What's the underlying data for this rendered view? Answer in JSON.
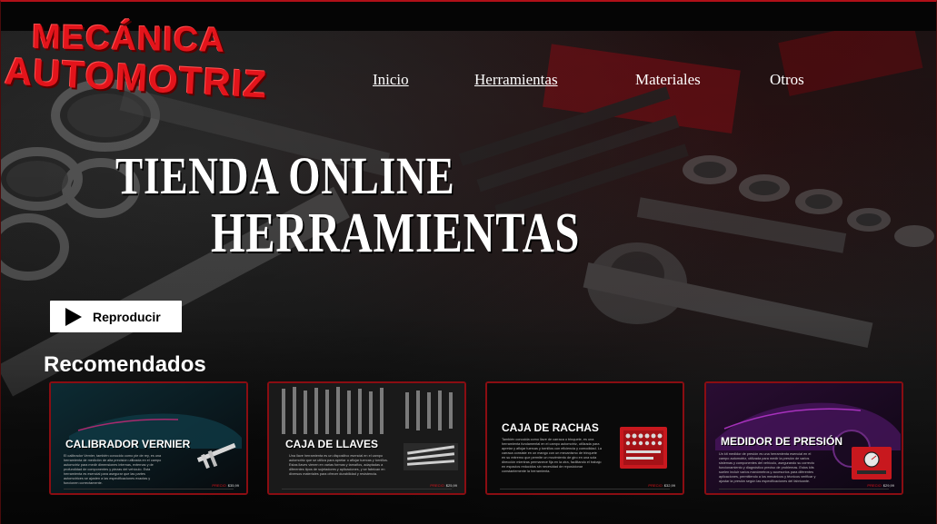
{
  "logo": {
    "line1": "MECÁNICA",
    "line2": "AUTOMOTRIZ"
  },
  "nav": {
    "items": [
      {
        "label": "Inicio"
      },
      {
        "label": "Herramientas"
      },
      {
        "label": "Materiales"
      },
      {
        "label": "Otros"
      }
    ]
  },
  "hero": {
    "line1": "TIENDA ONLINE",
    "line2": "HERRAMIENTAS"
  },
  "play_button": {
    "label": "Reproducir"
  },
  "recommended": {
    "title": "Recomendados",
    "cards": [
      {
        "title": "CALIBRADOR VERNIER",
        "description": "El calibrador Vernier, también conocido como pie de rey, es una herramienta de medición de alta precisión utilizada en el campo automotriz para medir dimensiones internas, externas y de profundidad de componentes y piezas del vehículo. Esta herramienta es esencial para asegurar que las partes automotrices se ajusten a las especificaciones exactas y funcionen correctamente.",
        "price_label": "PRECIO",
        "price": "$35,99"
      },
      {
        "title": "CAJA DE LLAVES",
        "description": "Una llave herramienta es un dispositivo esencial en el campo automotriz que se utiliza para apretar o aflojar tuercas y tornillos. Estas llaves vienen en varias formas y tamaños, adaptadas a diferentes tipos de sujetadores y aplicaciones, y se fabrican en diversos materiales para ofrecer durabilidad y resistencia.",
        "price_label": "PRECIO",
        "price": "$25,99"
      },
      {
        "title": "CAJA DE RACHAS",
        "description": "También conocida como llave de carraca o trinquete, es una herramienta fundamental en el campo automotriz, utilizada para apretar y aflojar tuercas y tornillos con eficiencia y comodidad. La carraca consiste en un mango con un mecanismo de trinquete en su extremo que permite un movimiento de giro en una sola dirección mientras permanece fija en la otra, facilitando el trabajo en espacios reducidos sin necesidad de reposicionar constantemente la herramienta.",
        "price_label": "PRECIO",
        "price": "$32,99"
      },
      {
        "title": "MEDIDOR DE PRESIÓN",
        "description": "Un kit medidor de presión es una herramienta esencial en el campo automotriz, utilizada para medir la presión de varios sistemas y componentes del vehículo, asegurando su correcto funcionamiento y diagnóstico preciso de problemas. Estos kits suelen incluir varios manómetros y accesorios para diferentes aplicaciones, permitiendo a los mecánicos y técnicos verificar y ajustar la presión según las especificaciones del fabricante.",
        "price_label": "PRECIO",
        "price": "$29,99"
      }
    ]
  },
  "colors": {
    "accent": "#e3141b",
    "card_border": "#8a0d12",
    "background": "#0b0b0b"
  }
}
